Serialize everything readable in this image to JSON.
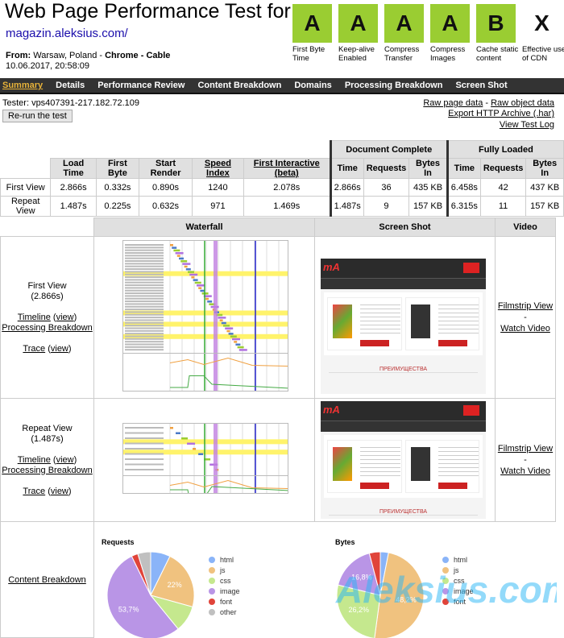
{
  "header": {
    "title": "Web Page Performance Test for",
    "url": "magazin.aleksius.com/",
    "from_label": "From:",
    "from_location": "Warsaw, Poland - ",
    "browser": "Chrome",
    "sep": " - ",
    "connection": "Cable",
    "date": "10.06.2017, 20:58:09"
  },
  "grades": [
    {
      "grade": "A",
      "label": "First Byte Time",
      "color": "#9acd32"
    },
    {
      "grade": "A",
      "label": "Keep-alive Enabled",
      "color": "#9acd32"
    },
    {
      "grade": "A",
      "label": "Compress Transfer",
      "color": "#9acd32"
    },
    {
      "grade": "A",
      "label": "Compress Images",
      "color": "#9acd32"
    },
    {
      "grade": "B",
      "label": "Cache static content",
      "color": "#9acd32"
    },
    {
      "grade": "X",
      "label": "Effective use of CDN",
      "color": "none"
    }
  ],
  "nav": [
    "Summary",
    "Details",
    "Performance Review",
    "Content Breakdown",
    "Domains",
    "Processing Breakdown",
    "Screen Shot"
  ],
  "tester": "Tester: vps407391-217.182.72.109",
  "rerun": "Re-run the test",
  "links": {
    "raw_page": "Raw page data",
    "dash": " - ",
    "raw_object": "Raw object data",
    "har": "Export HTTP Archive (.har)",
    "log": "View Test Log"
  },
  "summary": {
    "group_doc": "Document Complete",
    "group_full": "Fully Loaded",
    "headers": [
      "Load Time",
      "First Byte",
      "Start Render",
      "Speed Index",
      "First Interactive (beta)",
      "Time",
      "Requests",
      "Bytes In",
      "Time",
      "Requests",
      "Bytes In"
    ],
    "rows": [
      {
        "label": "First View",
        "cells": [
          "2.866s",
          "0.332s",
          "0.890s",
          "1240",
          "2.078s",
          "2.866s",
          "36",
          "435 KB",
          "6.458s",
          "42",
          "437 KB"
        ]
      },
      {
        "label": "Repeat View",
        "cells": [
          "1.487s",
          "0.225s",
          "0.632s",
          "971",
          "1.469s",
          "1.487s",
          "9",
          "157 KB",
          "6.315s",
          "11",
          "157 KB"
        ]
      }
    ]
  },
  "details": {
    "headers": [
      "Waterfall",
      "Screen Shot",
      "Video"
    ],
    "first": {
      "label": "First View",
      "time": "(2.866s)",
      "timeline": "Timeline",
      "view": "view",
      "processing": "Processing Breakdown",
      "trace": "Trace"
    },
    "repeat": {
      "label": "Repeat View",
      "time": "(1.487s)",
      "timeline": "Timeline",
      "view": "view",
      "processing": "Processing Breakdown",
      "trace": "Trace"
    },
    "filmstrip": "Filmstrip View",
    "dash": "-",
    "watch": "Watch Video",
    "content_breakdown": "Content Breakdown",
    "screenshot_text": {
      "logo": "mA",
      "heading": "ПРЕИМУЩЕСТВА"
    }
  },
  "chart_data": [
    {
      "type": "pie",
      "title": "Requests",
      "categories": [
        "html",
        "js",
        "css",
        "image",
        "font",
        "other"
      ],
      "values": [
        7.3,
        22,
        9.8,
        53.7,
        2.4,
        4.8
      ],
      "labels_shown": {
        "js": "22%",
        "image": "53,7%"
      },
      "colors": [
        "#8ab4f8",
        "#f0c27f",
        "#c5e88e",
        "#b995e6",
        "#e0443a",
        "#c0c0c0"
      ],
      "legend": "right"
    },
    {
      "type": "pie",
      "title": "Bytes",
      "categories": [
        "html",
        "js",
        "css",
        "image",
        "font"
      ],
      "values": [
        3,
        48.2,
        26.2,
        16.8,
        4
      ],
      "labels_shown": {
        "js": "48,2%",
        "css": "26,2%",
        "image": "16,8%"
      },
      "colors": [
        "#8ab4f8",
        "#f0c27f",
        "#c5e88e",
        "#b995e6",
        "#e0443a"
      ],
      "legend": "right"
    }
  ],
  "watermark": "Aleksius.com"
}
